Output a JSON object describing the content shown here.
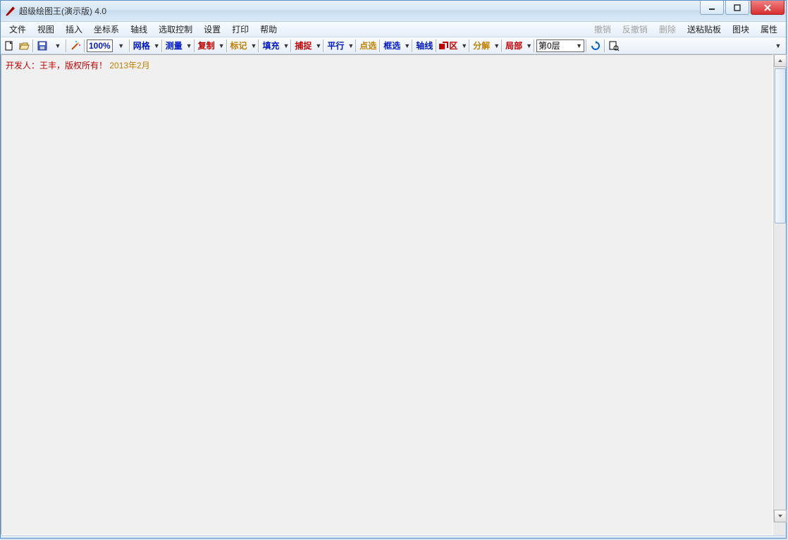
{
  "window": {
    "title": "超级绘图王(演示版) 4.0"
  },
  "menu": {
    "items": [
      "文件",
      "视图",
      "插入",
      "坐标系",
      "轴线",
      "选取控制",
      "设置",
      "打印",
      "帮助"
    ],
    "right": [
      {
        "label": "撤销",
        "enabled": false
      },
      {
        "label": "反撤销",
        "enabled": false
      },
      {
        "label": "删除",
        "enabled": false
      },
      {
        "label": "送粘贴板",
        "enabled": true
      },
      {
        "label": "图块",
        "enabled": true
      },
      {
        "label": "属性",
        "enabled": true
      }
    ]
  },
  "toolbar": {
    "zoom": "100%",
    "groups": [
      {
        "label": "网格",
        "color": "blue"
      },
      {
        "label": "测量",
        "color": "blue"
      },
      {
        "label": "复制",
        "color": "red"
      },
      {
        "label": "标记",
        "color": "orange"
      },
      {
        "label": "填充",
        "color": "blue"
      },
      {
        "label": "捕捉",
        "color": "red"
      },
      {
        "label": "平行",
        "color": "blue"
      },
      {
        "label": "点选",
        "color": "orange"
      },
      {
        "label": "框选",
        "color": "blue"
      },
      {
        "label": "轴线",
        "color": "blue"
      },
      {
        "label": "退区",
        "color": "red",
        "icon": true
      },
      {
        "label": "分解",
        "color": "orange"
      },
      {
        "label": "局部",
        "color": "red"
      }
    ],
    "layer": "第0层"
  },
  "canvas": {
    "dev_prefix": "开发人：王丰，版权所有！",
    "dev_date": "2013年2月"
  }
}
